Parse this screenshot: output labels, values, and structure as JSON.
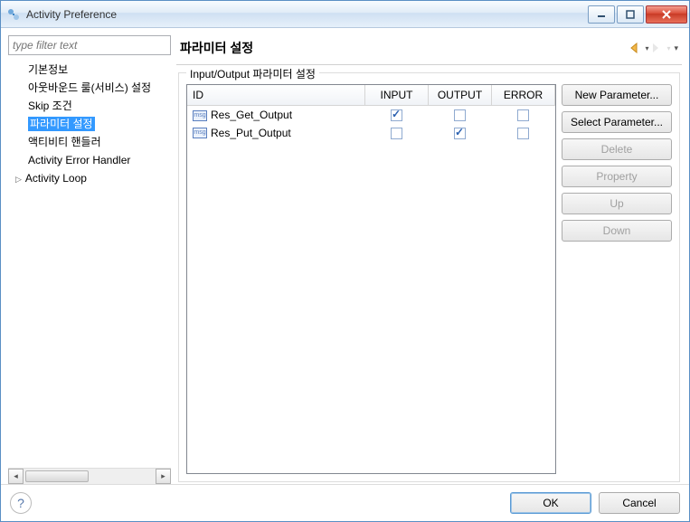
{
  "window": {
    "title": "Activity Preference"
  },
  "left": {
    "filter_placeholder": "type filter text",
    "items": [
      {
        "label": "기본정보"
      },
      {
        "label": "아웃바운드 룰(서비스) 설정"
      },
      {
        "label": "Skip 조건"
      },
      {
        "label": "파라미터 설정",
        "selected": true
      },
      {
        "label": "액티비티 핸들러"
      },
      {
        "label": "Activity Error Handler"
      },
      {
        "label": "Activity Loop",
        "expandable": true
      }
    ]
  },
  "panel": {
    "title": "파라미터 설정",
    "group_label": "Input/Output 파라미터 설정",
    "columns": {
      "id": "ID",
      "input": "INPUT",
      "output": "OUTPUT",
      "error": "ERROR"
    },
    "rows": [
      {
        "id": "Res_Get_Output",
        "input": true,
        "output": false,
        "error": false
      },
      {
        "id": "Res_Put_Output",
        "input": false,
        "output": true,
        "error": false
      }
    ],
    "actions": {
      "new_parameter": "New Parameter...",
      "select_parameter": "Select Parameter...",
      "delete": "Delete",
      "property": "Property",
      "up": "Up",
      "down": "Down"
    }
  },
  "footer": {
    "ok": "OK",
    "cancel": "Cancel"
  }
}
